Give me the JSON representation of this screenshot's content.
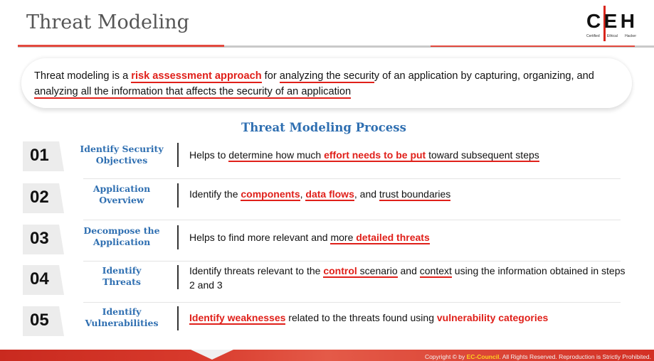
{
  "header": {
    "title": "Threat Modeling",
    "logo": {
      "letters": [
        "C",
        "E",
        "H"
      ],
      "tag": [
        "Certified",
        "Ethical",
        "Hacker"
      ]
    }
  },
  "intro": {
    "segments": [
      {
        "text": "Threat modeling is a ",
        "style": "plain"
      },
      {
        "text": "risk assessment approach",
        "style": "highlight-underline"
      },
      {
        "text": " for ",
        "style": "plain"
      },
      {
        "text": "analyzing the securit",
        "style": "underline"
      },
      {
        "text": "y of an application by capturing, organizing, and ",
        "style": "plain"
      },
      {
        "text": "analyzing all the information that affects the security of an application",
        "style": "underline"
      }
    ]
  },
  "process": {
    "title": "Threat Modeling Process",
    "steps": [
      {
        "number": "01",
        "label_lines": [
          "Identify Security",
          "Objectives"
        ],
        "segments": [
          {
            "text": "Helps to ",
            "style": "plain"
          },
          {
            "text": "determine how much ",
            "style": "underline"
          },
          {
            "text": "effort needs to be put",
            "style": "highlight-underline"
          },
          {
            "text": " toward subsequent steps",
            "style": "underline"
          }
        ]
      },
      {
        "number": "02",
        "label_lines": [
          "Application",
          "Overview"
        ],
        "segments": [
          {
            "text": "Identify the ",
            "style": "plain"
          },
          {
            "text": "components",
            "style": "highlight-underline"
          },
          {
            "text": ", ",
            "style": "plain"
          },
          {
            "text": "data flows",
            "style": "highlight-underline"
          },
          {
            "text": ", and ",
            "style": "plain"
          },
          {
            "text": "trust boundaries",
            "style": "underline"
          }
        ]
      },
      {
        "number": "03",
        "label_lines": [
          "Decompose the",
          "Application"
        ],
        "segments": [
          {
            "text": "Helps to find more relevant and ",
            "style": "plain"
          },
          {
            "text": "more ",
            "style": "underline"
          },
          {
            "text": "detailed threats",
            "style": "highlight-underline"
          }
        ]
      },
      {
        "number": "04",
        "label_lines": [
          "Identify",
          "Threats"
        ],
        "segments": [
          {
            "text": "Identify threats relevant to the ",
            "style": "plain"
          },
          {
            "text": "control",
            "style": "highlight-underline"
          },
          {
            "text": " scenario",
            "style": "underline"
          },
          {
            "text": " and ",
            "style": "plain"
          },
          {
            "text": "context",
            "style": "underline"
          },
          {
            "text": " using the information obtained in steps 2 and 3",
            "style": "plain"
          }
        ]
      },
      {
        "number": "05",
        "label_lines": [
          "Identify",
          "Vulnerabilities"
        ],
        "segments": [
          {
            "text": "Identify weaknesses",
            "style": "highlight-underline"
          },
          {
            "text": " related to the threats found using ",
            "style": "plain"
          },
          {
            "text": "vulnerability categories",
            "style": "highlight"
          }
        ]
      }
    ]
  },
  "footer": {
    "prefix": "Copyright © by ",
    "brand": "EC-Council",
    "suffix": ". All Rights Reserved. Reproduction is Strictly Prohibited."
  },
  "colors": {
    "highlight": "#e0201a",
    "heading_blue": "#2f6fb1",
    "footer_red": "#d33024"
  }
}
